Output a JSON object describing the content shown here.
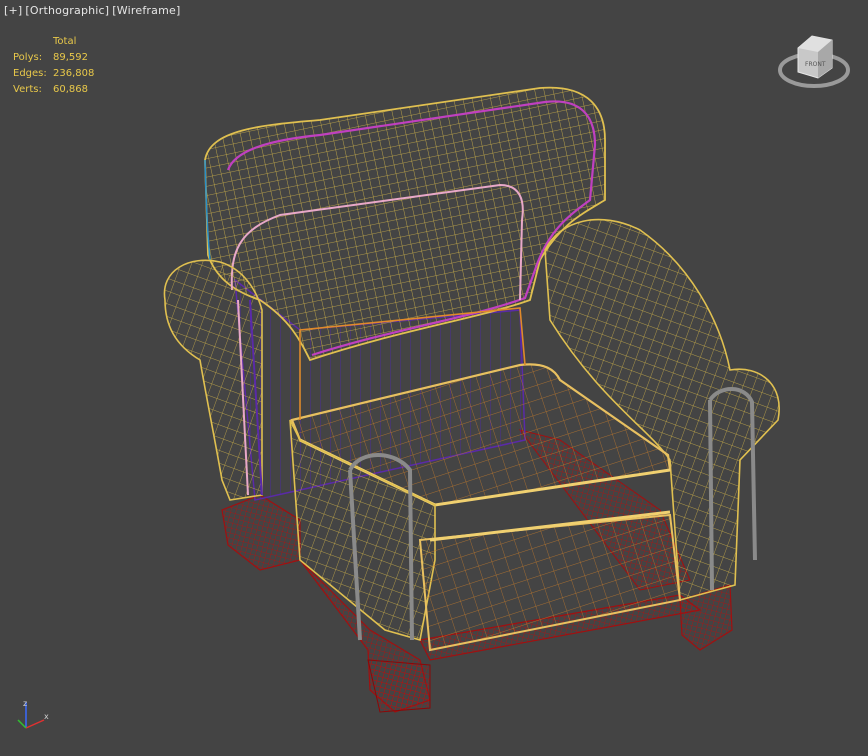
{
  "viewport": {
    "labels": [
      "[+]",
      "[Orthographic]",
      "[Wireframe]"
    ]
  },
  "stats": {
    "header": "Total",
    "rows": [
      {
        "label": "Polys:",
        "value": "89,592"
      },
      {
        "label": "Edges:",
        "value": "236,808"
      },
      {
        "label": "Verts:",
        "value": "60,868"
      }
    ]
  },
  "viewcube": {
    "face_label": "FRONT"
  },
  "axis_tripod": {
    "x": "x",
    "z": "z"
  },
  "colors": {
    "background": "#444444",
    "wire_yellow": "#e0c050",
    "wire_orange": "#e08a2a",
    "wire_red": "#b01010",
    "wire_purple": "#5a2aa8",
    "wire_pink": "#e0a0c0",
    "wire_magenta": "#c040c0",
    "wire_gray": "#8a8a8a"
  },
  "object": {
    "name": "armchair",
    "render_mode": "wireframe"
  }
}
